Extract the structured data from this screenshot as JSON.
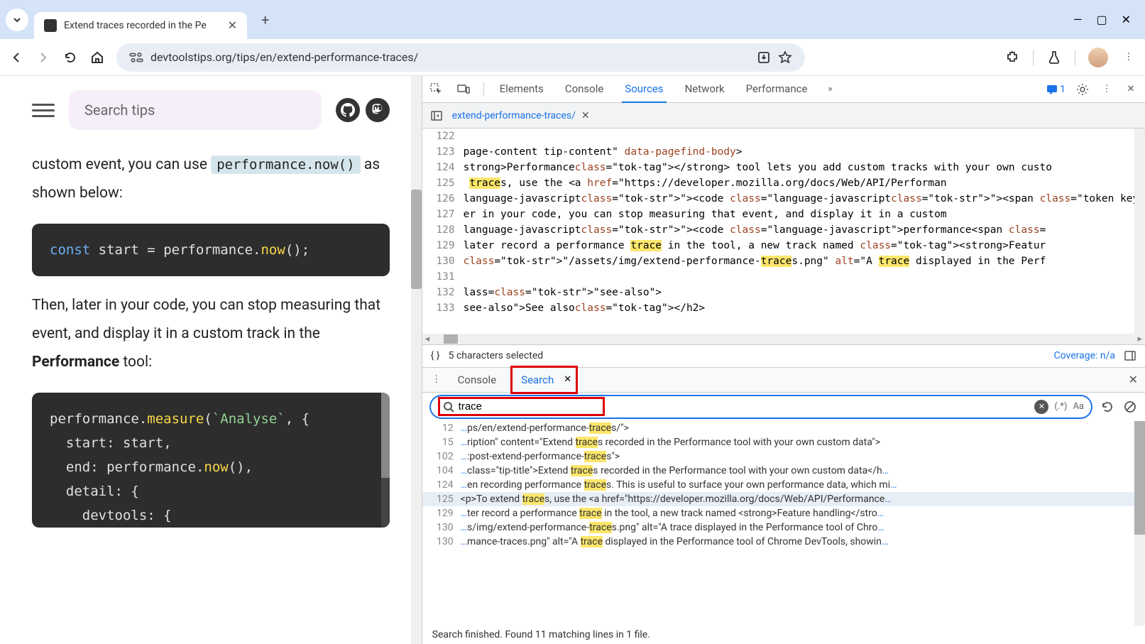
{
  "browser": {
    "tab_title": "Extend traces recorded in the Pe",
    "url": "devtoolstips.org/tips/en/extend-performance-traces/"
  },
  "page": {
    "search_placeholder": "Search tips",
    "para1_prefix": "custom event, you can use ",
    "para1_code": "performance.now()",
    "para1_suffix": " as shown below:",
    "codeblock1": "const start = performance.now();",
    "para2": "Then, later in your code, you can stop measuring that event, and display it in a custom track in the ",
    "para2_strong": "Performance",
    "para2_suffix": " tool:",
    "codeblock2": "performance.measure(`Analyse`, {\n  start: start,\n  end: performance.now(),\n  detail: {\n    devtools: {"
  },
  "devtools": {
    "tabs": [
      "Elements",
      "Console",
      "Sources",
      "Network",
      "Performance"
    ],
    "active_tab": "Sources",
    "msg_count": "1",
    "file_tab": "extend-performance-traces/",
    "gutter_start": 122,
    "code_lines": [
      " ",
      "page-content tip-content\" data-pagefind-body>",
      "strong>Performance</strong> tool lets you add custom tracks with your own custo",
      " traces, use the <a href=\"https://developer.mozilla.org/docs/Web/API/Performan",
      "language-javascript\"><code class=\"language-javascript\"><span class=\"token keyw",
      "er in your code, you can stop measuring that event, and display it in a custom",
      "language-javascript\"><code class=\"language-javascript\">performance<span class=",
      "later record a performance trace in the tool, a new track named <strong>Featur",
      "\"/assets/img/extend-performance-traces.png\" alt=\"A trace displayed in the Perf",
      " ",
      "lass=\"see-also\">",
      "see-also\">See also</h2>"
    ],
    "status_selected": "5 characters selected",
    "coverage": "Coverage: n/a"
  },
  "drawer": {
    "tabs": [
      "Console",
      "Search"
    ],
    "active_tab": "Search",
    "search_value": "trace",
    "results": [
      {
        "line": 12,
        "prefix": "…ps/en/extend-performance-",
        "match": "trace",
        "suffix": "s/\">",
        "selected": false
      },
      {
        "line": 15,
        "prefix": "…ription\" content=\"Extend ",
        "match": "trace",
        "suffix": "s recorded in the Performance tool with your own custom data\">",
        "selected": false
      },
      {
        "line": 102,
        "prefix": "…:post-extend-performance-",
        "match": "trace",
        "suffix": "s\">",
        "selected": false
      },
      {
        "line": 104,
        "prefix": "…class=\"tip-title\">Extend ",
        "match": "trace",
        "suffix": "s recorded in the Performance tool with your own custom data</h…",
        "selected": false
      },
      {
        "line": 124,
        "prefix": "…en recording performance ",
        "match": "trace",
        "suffix": "s. This is useful to surface your own performance data, which mi…",
        "selected": false
      },
      {
        "line": 125,
        "prefix": "<p>To extend ",
        "match": "trace",
        "suffix": "s, use the <a href=\"https://developer.mozilla.org/docs/Web/API/Performance…",
        "selected": true
      },
      {
        "line": 129,
        "prefix": "…ter record a performance ",
        "match": "trace",
        "suffix": " in the tool, a new track named <strong>Feature handling</stro…",
        "selected": false
      },
      {
        "line": 130,
        "prefix": "…s/img/extend-performance-",
        "match": "trace",
        "suffix": "s.png\" alt=\"A trace displayed in the Performance tool of Chro…",
        "selected": false
      },
      {
        "line": 130,
        "prefix": "…mance-traces.png\" alt=\"A ",
        "match": "trace",
        "suffix": " displayed in the Performance tool of Chrome DevTools, showin…",
        "selected": false
      }
    ],
    "status": "Search finished.  Found 11 matching lines in 1 file."
  }
}
